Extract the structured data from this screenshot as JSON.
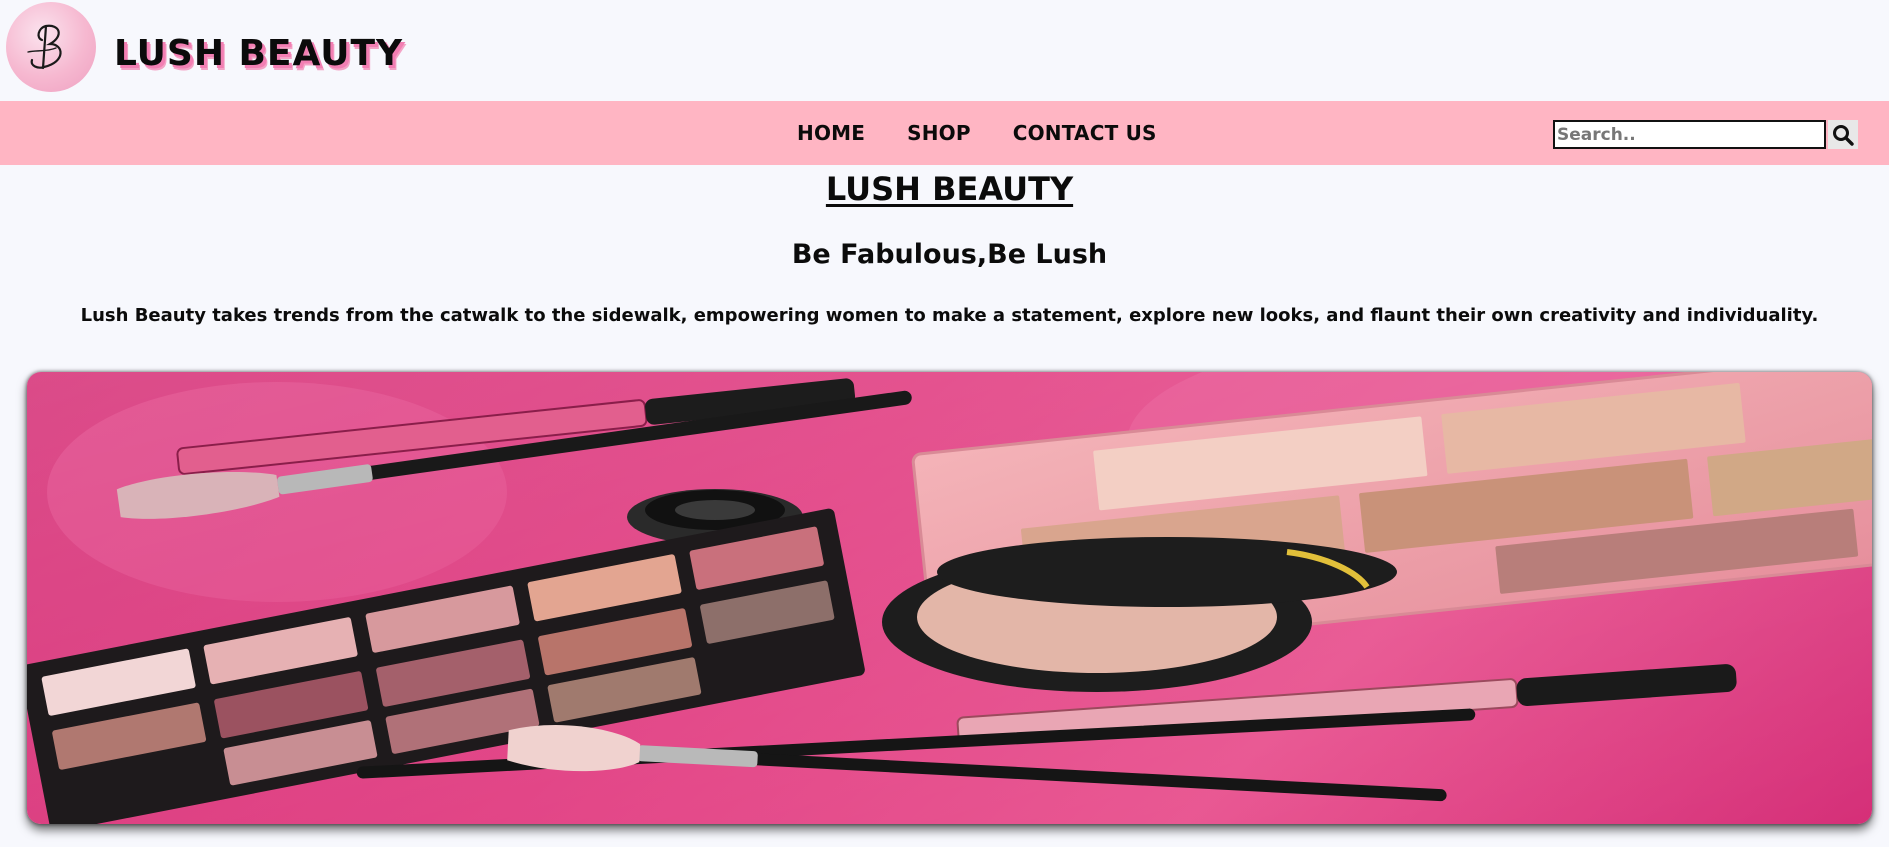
{
  "brand": {
    "logo_letter": "B",
    "name": "LUSH BEAUTY"
  },
  "nav": {
    "items": [
      "HOME",
      "SHOP",
      "CONTACT US"
    ]
  },
  "search": {
    "placeholder": "Search.."
  },
  "main": {
    "title": "LUSH BEAUTY",
    "tagline": "Be Fabulous,Be Lush",
    "description": "Lush Beauty takes trends from the catwalk to the sidewalk, empowering women to make a statement, explore new looks, and flaunt their own creativity and individuality."
  },
  "icons": {
    "search": "search-icon",
    "logo": "monogram-logo-icon"
  },
  "colors": {
    "background": "#f7f8fd",
    "navbar": "#ffb5c3",
    "hero_pink": "#d3246f",
    "text": "#0b0b0b"
  }
}
